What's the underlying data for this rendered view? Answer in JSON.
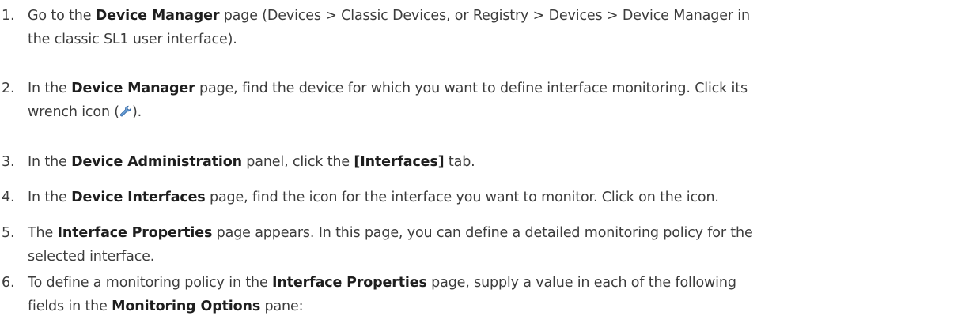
{
  "steps": [
    {
      "number": "1.",
      "parts": [
        "Go to the ",
        "Device Manager",
        " page (Devices > Classic Devices, or Registry > Devices > Device Manager in",
        "the classic SL1 user interface)."
      ]
    },
    {
      "number": "2.",
      "parts": [
        "In the ",
        "Device Manager",
        " page, find the device for which you want to define interface monitoring. Click its",
        "wrench icon (",
        ")."
      ]
    },
    {
      "number": "3.",
      "parts": [
        "In the ",
        "Device Administration",
        " panel, click the ",
        "[Interfaces]",
        " tab."
      ]
    },
    {
      "number": "4.",
      "parts": [
        "In the ",
        "Device Interfaces",
        " page, find the icon for the interface you want to monitor. Click on the icon."
      ]
    },
    {
      "number": "5.",
      "parts": [
        "The ",
        "Interface Properties",
        " page appears. In this page, you can define a detailed monitoring policy for the",
        "selected interface."
      ]
    },
    {
      "number": "6.",
      "parts": [
        "To define a monitoring policy in the ",
        "Interface Properties",
        " page, supply a value in each of the following",
        "fields in the ",
        "Monitoring Options",
        " pane:"
      ]
    }
  ],
  "icons": {
    "wrench": "wrench-icon",
    "wrench_color": "#4a90d9"
  }
}
